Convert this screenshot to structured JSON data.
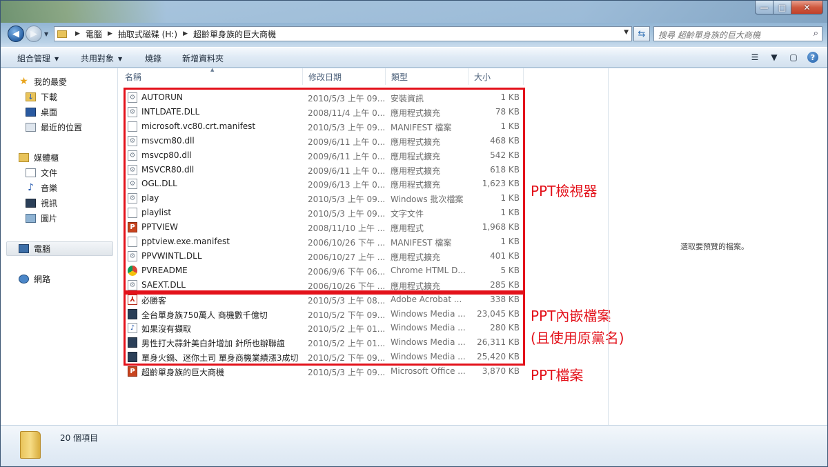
{
  "window": {
    "controls": {
      "minimize": "—",
      "maximize": "□",
      "close": "✕"
    }
  },
  "nav": {
    "breadcrumb": [
      "電腦",
      "抽取式磁碟 (H:)",
      "超齡單身族的巨大商機"
    ],
    "search_placeholder": "搜尋 超齡單身族的巨大商機"
  },
  "toolbar": {
    "organize": "組合管理",
    "share": "共用對象",
    "burn": "燒錄",
    "new_folder": "新增資料夾"
  },
  "sidebar": {
    "favorites": {
      "label": "我的最愛",
      "items": [
        "下載",
        "桌面",
        "最近的位置"
      ]
    },
    "libraries": {
      "label": "媒體櫃",
      "items": [
        "文件",
        "音樂",
        "視訊",
        "圖片"
      ]
    },
    "computer": "電腦",
    "network": "網路"
  },
  "columns": {
    "name": "名稱",
    "date": "修改日期",
    "type": "類型",
    "size": "大小"
  },
  "files": [
    {
      "name": "AUTORUN",
      "date": "2010/5/3 上午 09...",
      "type": "安裝資訊",
      "size": "1 KB",
      "icon": "gear"
    },
    {
      "name": "INTLDATE.DLL",
      "date": "2008/11/4 上午 0...",
      "type": "應用程式擴充",
      "size": "78 KB",
      "icon": "gear"
    },
    {
      "name": "microsoft.vc80.crt.manifest",
      "date": "2010/5/3 上午 09...",
      "type": "MANIFEST 檔案",
      "size": "1 KB",
      "icon": "doc"
    },
    {
      "name": "msvcm80.dll",
      "date": "2009/6/11 上午 0...",
      "type": "應用程式擴充",
      "size": "468 KB",
      "icon": "gear"
    },
    {
      "name": "msvcp80.dll",
      "date": "2009/6/11 上午 0...",
      "type": "應用程式擴充",
      "size": "542 KB",
      "icon": "gear"
    },
    {
      "name": "MSVCR80.dll",
      "date": "2009/6/11 上午 0...",
      "type": "應用程式擴充",
      "size": "618 KB",
      "icon": "gear"
    },
    {
      "name": "OGL.DLL",
      "date": "2009/6/13 上午 0...",
      "type": "應用程式擴充",
      "size": "1,623 KB",
      "icon": "gear"
    },
    {
      "name": "play",
      "date": "2010/5/3 上午 09...",
      "type": "Windows 批次檔案",
      "size": "1 KB",
      "icon": "gear"
    },
    {
      "name": "playlist",
      "date": "2010/5/3 上午 09...",
      "type": "文字文件",
      "size": "1 KB",
      "icon": "doc"
    },
    {
      "name": "PPTVIEW",
      "date": "2008/11/10 上午 ...",
      "type": "應用程式",
      "size": "1,968 KB",
      "icon": "ppt"
    },
    {
      "name": "pptview.exe.manifest",
      "date": "2006/10/26 下午 ...",
      "type": "MANIFEST 檔案",
      "size": "1 KB",
      "icon": "doc"
    },
    {
      "name": "PPVWINTL.DLL",
      "date": "2006/10/27 上午 ...",
      "type": "應用程式擴充",
      "size": "401 KB",
      "icon": "gear"
    },
    {
      "name": "PVREADME",
      "date": "2006/9/6 下午 06...",
      "type": "Chrome HTML D...",
      "size": "5 KB",
      "icon": "chrome"
    },
    {
      "name": "SAEXT.DLL",
      "date": "2006/10/26 下午 ...",
      "type": "應用程式擴充",
      "size": "285 KB",
      "icon": "gear"
    },
    {
      "name": "必勝客",
      "date": "2010/5/3 上午 08...",
      "type": "Adobe Acrobat ...",
      "size": "338 KB",
      "icon": "pdf"
    },
    {
      "name": "全台單身族750萬人 商機數千億切",
      "date": "2010/5/2 下午 09...",
      "type": "Windows Media ...",
      "size": "23,045 KB",
      "icon": "media"
    },
    {
      "name": "如果沒有擷取",
      "date": "2010/5/2 上午 01...",
      "type": "Windows Media ...",
      "size": "280 KB",
      "icon": "audio"
    },
    {
      "name": "男性打大蒜針美白針增加 針所也辦聯誼",
      "date": "2010/5/2 上午 01...",
      "type": "Windows Media ...",
      "size": "26,311 KB",
      "icon": "media"
    },
    {
      "name": "單身火鍋、迷你土司 單身商機業績漲3成切",
      "date": "2010/5/2 下午 09...",
      "type": "Windows Media ...",
      "size": "25,420 KB",
      "icon": "media"
    },
    {
      "name": "超齡單身族的巨大商機",
      "date": "2010/5/3 上午 09...",
      "type": "Microsoft Office ...",
      "size": "3,870 KB",
      "icon": "ppt"
    }
  ],
  "annotations": {
    "viewer": "PPT檢視器",
    "embedded_line1": "PPT內嵌檔案",
    "embedded_line2": "(且使用原黨名)",
    "ppt_file": "PPT檔案"
  },
  "preview": {
    "message": "選取要預覽的檔案。"
  },
  "status": {
    "count": "20 個項目"
  }
}
